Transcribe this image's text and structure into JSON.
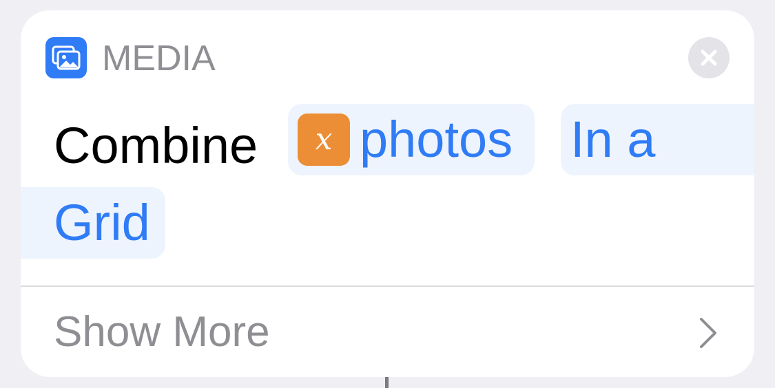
{
  "header": {
    "category_label": "MEDIA",
    "category_icon": "photo-gallery-icon",
    "close_icon": "close-icon"
  },
  "action": {
    "verb": "Combine",
    "variable_token": {
      "icon": "variable-icon",
      "glyph": "x",
      "label": "photos"
    },
    "mode_token": {
      "line1": "In a",
      "line2": "Grid"
    }
  },
  "footer": {
    "show_more_label": "Show More",
    "chevron_icon": "chevron-right-icon"
  },
  "colors": {
    "accent": "#2f7cf6",
    "variable_badge": "#ec8e36",
    "token_background": "#eef4fd",
    "secondary_text": "#8e8e93",
    "page_background": "#efeff4"
  }
}
